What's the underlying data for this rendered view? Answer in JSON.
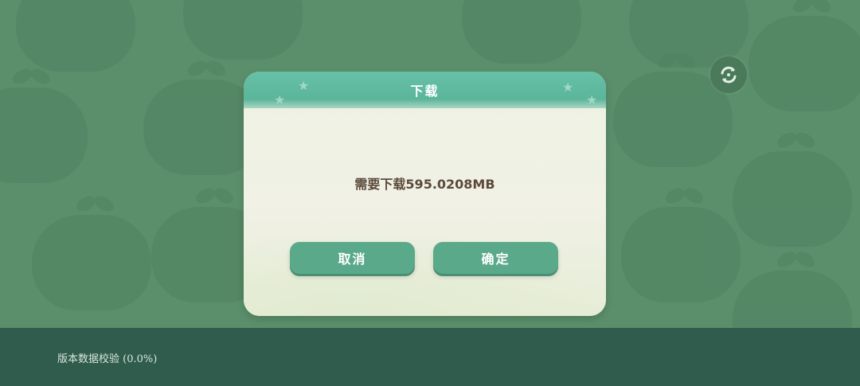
{
  "dialog": {
    "title": "下载",
    "message": "需要下载595.0208MB",
    "cancel_label": "取消",
    "confirm_label": "确定"
  },
  "status": {
    "text": "版本数据校验 (0.0%)",
    "progress_percent": 0.0
  },
  "icons": {
    "sync": "sync-icon"
  },
  "colors": {
    "background": "#5b8f6b",
    "header": "#5bb59a",
    "button": "#5aa98a",
    "status_bar": "#2f5c4d"
  }
}
